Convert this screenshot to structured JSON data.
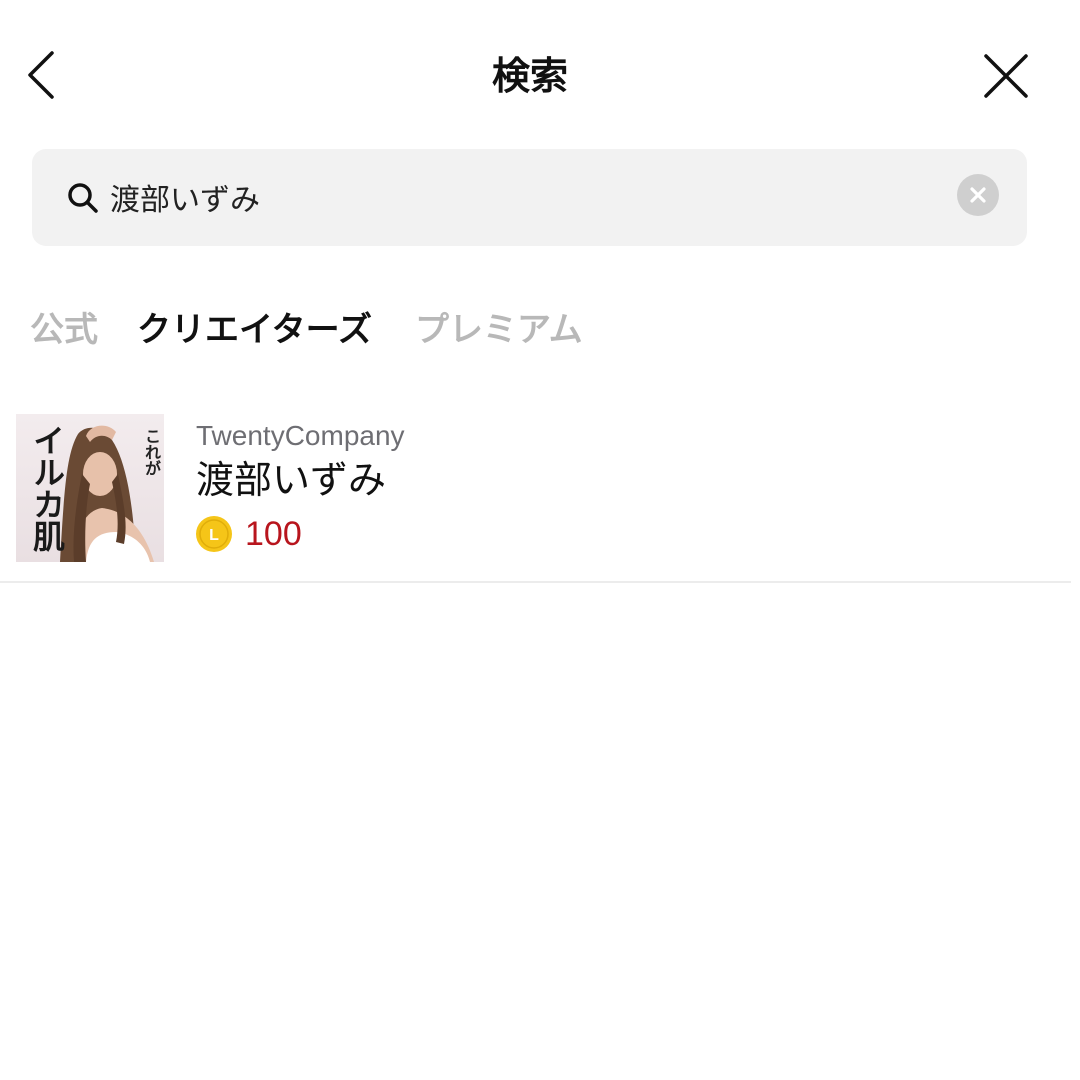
{
  "header": {
    "title": "検索",
    "back_icon": "chevron-left-icon",
    "close_icon": "close-icon"
  },
  "search": {
    "value": "渡部いずみ",
    "icon": "search-icon",
    "clear_icon": "clear-icon"
  },
  "tabs": [
    {
      "label": "公式",
      "active": false
    },
    {
      "label": "クリエイターズ",
      "active": true
    },
    {
      "label": "プレミアム",
      "active": false
    }
  ],
  "results": [
    {
      "publisher": "TwentyCompany",
      "title": "渡部いずみ",
      "price": "100",
      "coin_letter": "L",
      "thumbnail": {
        "text_small": "これが",
        "text_large": "イルカ肌"
      }
    }
  ],
  "colors": {
    "price": "#b8151d",
    "coin": "#f5c518",
    "tab_inactive": "#b8b8b8",
    "tab_active": "#111111",
    "search_bg": "#f2f2f2"
  }
}
